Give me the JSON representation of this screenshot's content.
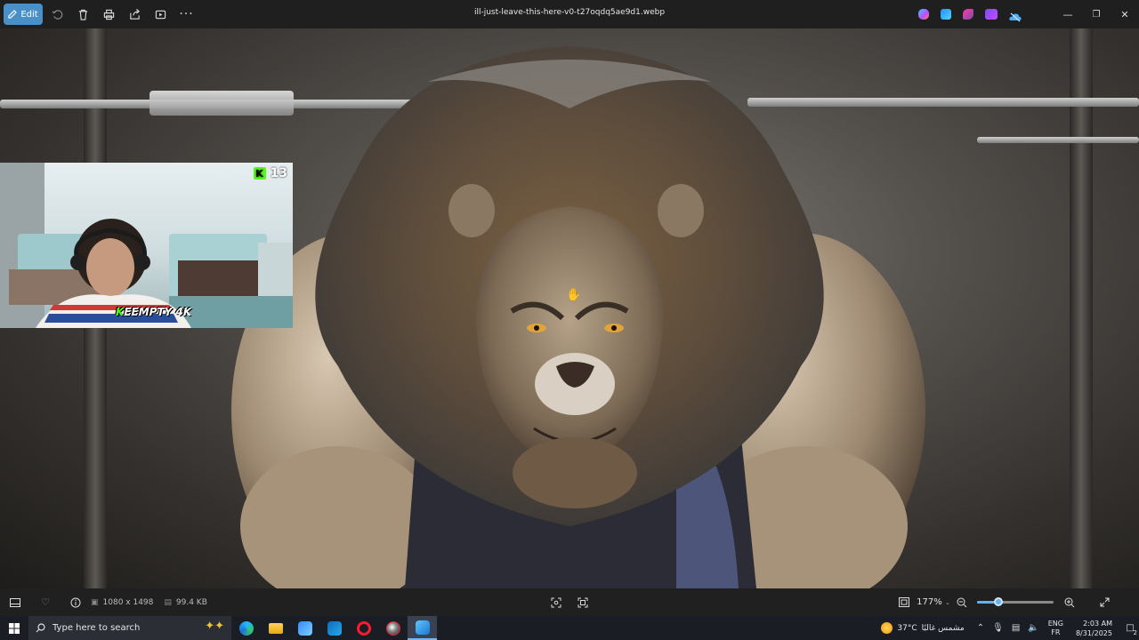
{
  "window": {
    "title": "ill-just-leave-this-here-v0-t27oqdq5ae9d1.webp",
    "edit_label": "Edit"
  },
  "webcam": {
    "counter": "13",
    "badge": "K",
    "brand_k": "K",
    "brand_rest": "EEMPTY 4K"
  },
  "info": {
    "dimensions": "1080 x 1498",
    "file_size": "99.4 KB",
    "zoom": "177%",
    "zoom_level": 0.28
  },
  "taskbar": {
    "search_placeholder": "Type here to search",
    "temperature": "37°C",
    "weather_text": "مشمس غالبًا",
    "lang_top": "ENG",
    "lang_bottom": "FR",
    "time": "2:03 AM",
    "date": "8/31/2025",
    "notification_count": "2"
  },
  "colors": {
    "accent": "#4a90c8",
    "kick_green": "#53fc18",
    "slider": "#5fb3f0"
  }
}
